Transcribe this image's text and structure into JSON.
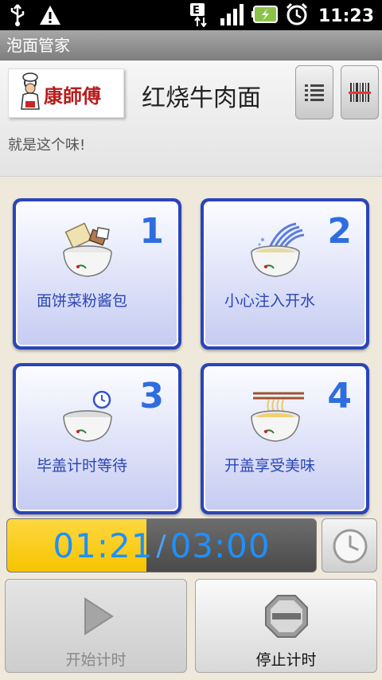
{
  "statusbar": {
    "time": "11:23"
  },
  "app": {
    "title": "泡面管家"
  },
  "product": {
    "name": "红烧牛肉面",
    "slogan": "就是这个味!",
    "logo_alt": "康师傅"
  },
  "steps": [
    {
      "number": "1",
      "label": "面饼菜粉酱包"
    },
    {
      "number": "2",
      "label": "小心注入开水"
    },
    {
      "number": "3",
      "label": "毕盖计时等待"
    },
    {
      "number": "4",
      "label": "开盖享受美味"
    }
  ],
  "timer": {
    "elapsed": "01:21",
    "separator": "/",
    "total": "03:00",
    "progress": 0.45
  },
  "controls": {
    "start_label": "开始计时",
    "stop_label": "停止计时"
  },
  "colors": {
    "card_border": "#2a45b8",
    "accent_blue": "#2e6de0",
    "timer_fill": "#f5c400"
  }
}
